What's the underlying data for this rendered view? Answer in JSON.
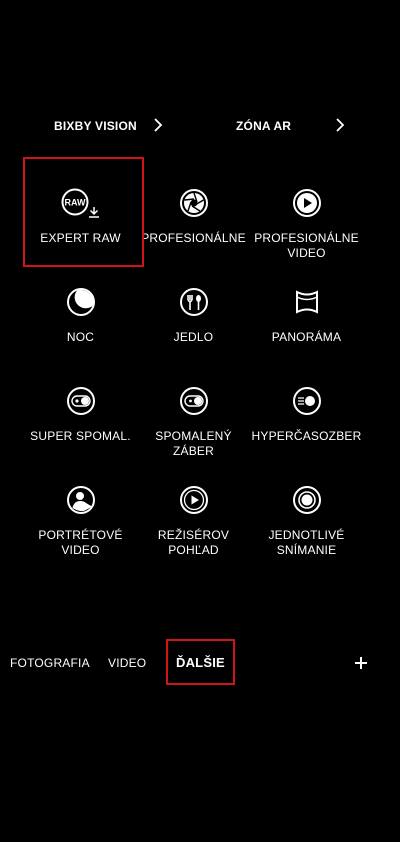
{
  "top_links": [
    {
      "label": "BIXBY VISION"
    },
    {
      "label": "ZÓNA AR"
    }
  ],
  "modes": [
    {
      "label": "EXPERT RAW",
      "icon": "raw-download-icon",
      "badge": "RAW"
    },
    {
      "label": "PROFESIONÁLNE",
      "icon": "aperture-icon"
    },
    {
      "label": "PROFESIONÁLNE\nVIDEO",
      "icon": "pro-video-icon"
    },
    {
      "label": "NOC",
      "icon": "moon-icon"
    },
    {
      "label": "JEDLO",
      "icon": "fork-spoon-icon"
    },
    {
      "label": "PANORÁMA",
      "icon": "panorama-icon"
    },
    {
      "label": "SUPER SPOMAL.",
      "icon": "super-slow-motion-icon"
    },
    {
      "label": "SPOMALENÝ\nZÁBER",
      "icon": "slow-motion-icon"
    },
    {
      "label": "HYPERČASOZBER",
      "icon": "hyperlapse-icon"
    },
    {
      "label": "PORTRÉTOVÉ\nVIDEO",
      "icon": "portrait-video-icon"
    },
    {
      "label": "REŽISÉROV\nPOHĽAD",
      "icon": "directors-view-icon"
    },
    {
      "label": "JEDNOTLIVÉ\nSNÍMANIE",
      "icon": "single-take-icon"
    }
  ],
  "bottom_tabs": [
    {
      "label": "FOTOGRAFIA"
    },
    {
      "label": "VIDEO"
    },
    {
      "label": "ĎALŠIE",
      "active": true
    }
  ],
  "colors": {
    "background": "#000000",
    "text": "#ffffff",
    "highlight": "#d0141a"
  }
}
